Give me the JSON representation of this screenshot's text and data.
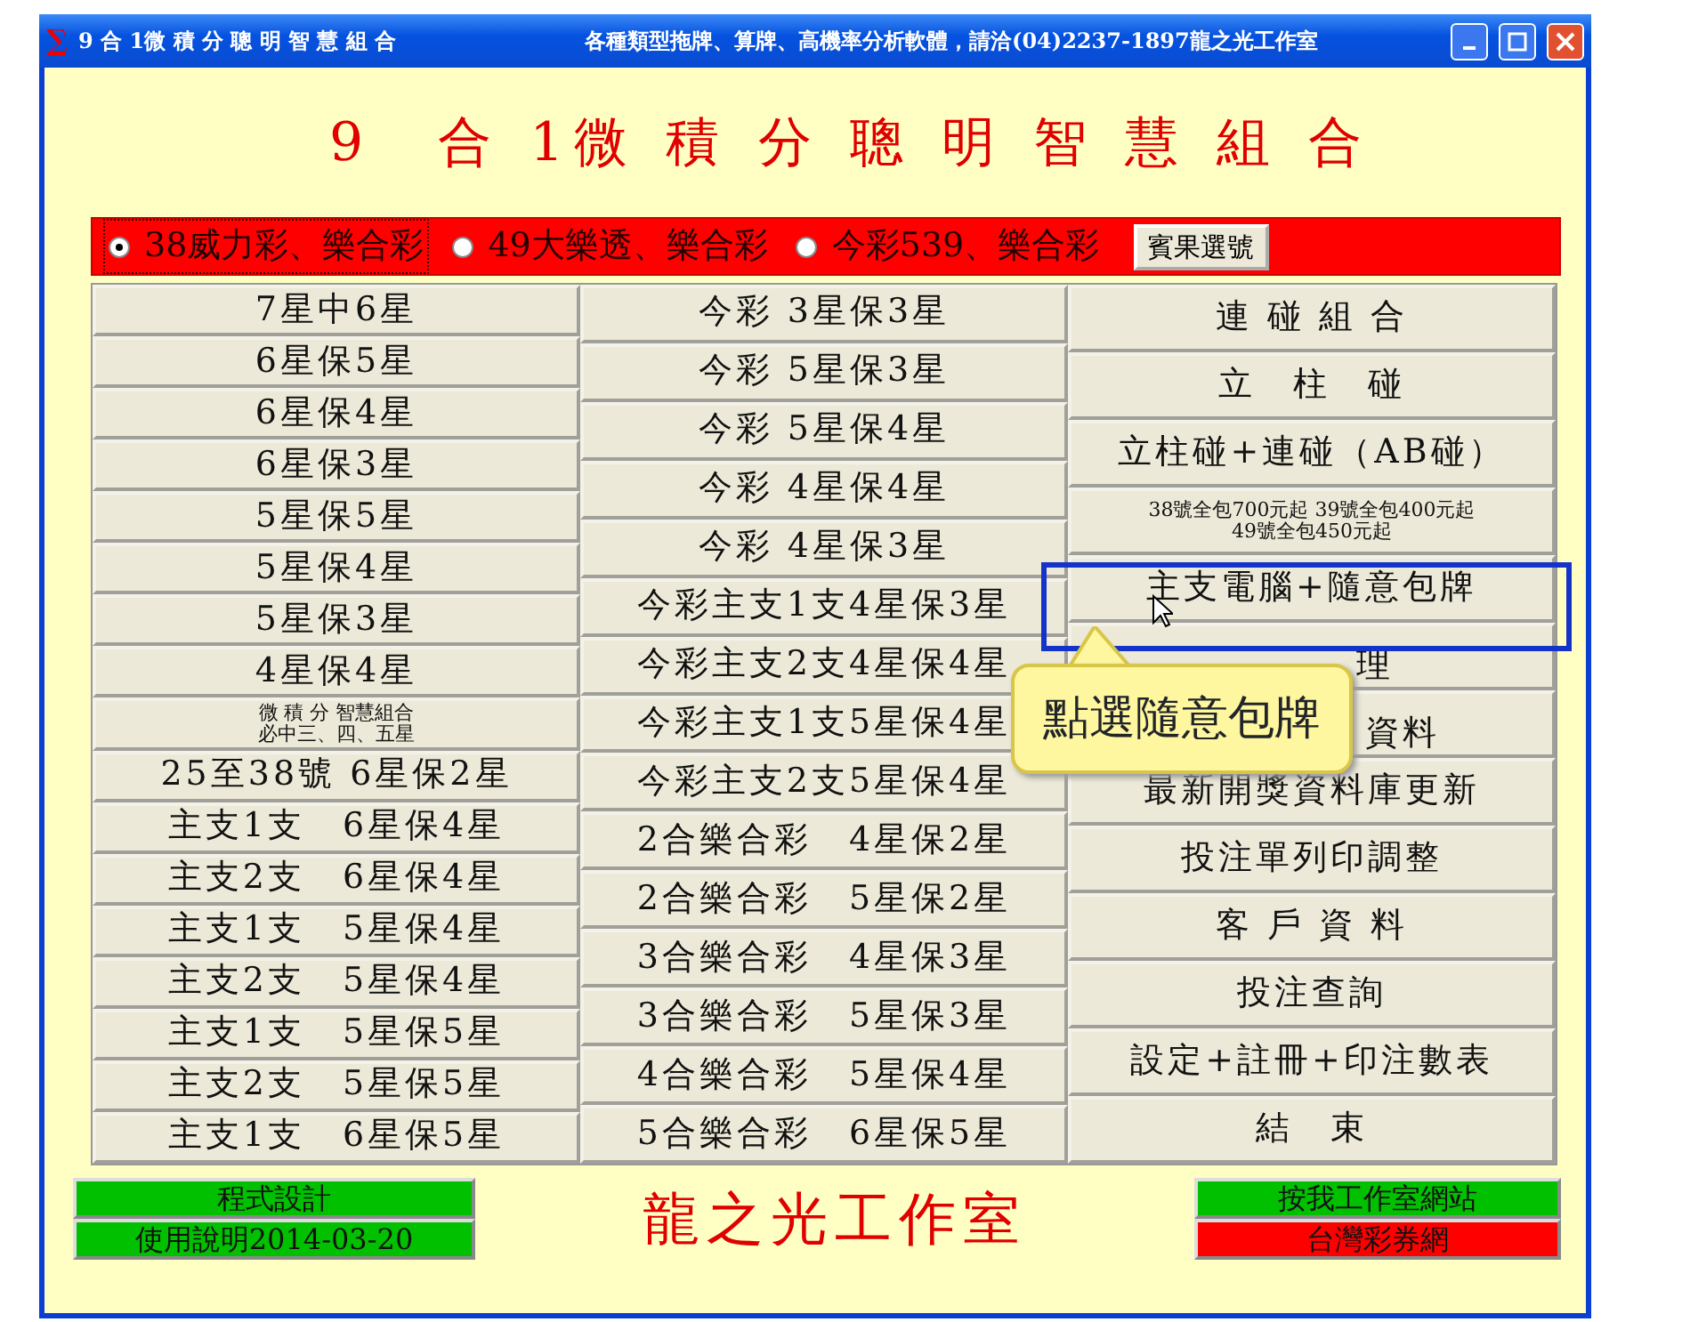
{
  "window": {
    "icon": "∑",
    "title": "9 合 1微 積 分 聰 明 智 慧 組 合",
    "subtitle": "各種類型拖牌、算牌、高機率分析軟體，請洽(04)2237-1897龍之光工作室"
  },
  "heading": "9　合 1微 積 分 聰 明 智 慧 組 合",
  "game_options": [
    {
      "label": "38威力彩、樂合彩",
      "selected": true
    },
    {
      "label": "49大樂透、樂合彩",
      "selected": false
    },
    {
      "label": "今彩539、樂合彩",
      "selected": false
    }
  ],
  "pick_button": "賓果選號",
  "column_1": [
    {
      "label": "7星中6星"
    },
    {
      "label": "6星保5星"
    },
    {
      "label": "6星保4星"
    },
    {
      "label": "6星保3星"
    },
    {
      "label": "5星保5星"
    },
    {
      "label": "5星保4星"
    },
    {
      "label": "5星保3星"
    },
    {
      "label": "4星保4星"
    },
    {
      "lines": [
        "微 積 分 智慧組合",
        "必中三、四、五星"
      ],
      "kind": "small"
    },
    {
      "label": "25至38號 6星保2星"
    },
    {
      "label": "主支1支　6星保4星"
    },
    {
      "label": "主支2支　6星保4星"
    },
    {
      "label": "主支1支　5星保4星"
    },
    {
      "label": "主支2支　5星保4星"
    },
    {
      "label": "主支1支　5星保5星"
    },
    {
      "label": "主支2支　5星保5星"
    },
    {
      "label": "主支1支　6星保5星"
    }
  ],
  "column_2": [
    {
      "label": "今彩 3星保3星"
    },
    {
      "label": "今彩 5星保3星"
    },
    {
      "label": "今彩 5星保4星"
    },
    {
      "label": "今彩 4星保4星"
    },
    {
      "label": "今彩 4星保3星"
    },
    {
      "label": "今彩主支1支4星保3星"
    },
    {
      "label": "今彩主支2支4星保4星"
    },
    {
      "label": "今彩主支1支5星保4星"
    },
    {
      "label": "今彩主支2支5星保4星"
    },
    {
      "label": "2合樂合彩　4星保2星"
    },
    {
      "label": "2合樂合彩　5星保2星"
    },
    {
      "label": "3合樂合彩　4星保3星"
    },
    {
      "label": "3合樂合彩　5星保3星"
    },
    {
      "label": "4合樂合彩　5星保4星"
    },
    {
      "label": "5合樂合彩　6星保5星"
    }
  ],
  "column_3": [
    {
      "label": "連 碰 組 合"
    },
    {
      "label": "立　柱　碰"
    },
    {
      "label": "立柱碰+連碰（AB碰）"
    },
    {
      "lines": [
        "38號全包700元起 39號全包400元起",
        "49號全包450元起"
      ],
      "kind": "small"
    },
    {
      "label": "主支電腦+隨意包牌",
      "highlighted": true
    },
    {
      "label": "理",
      "kind": "covered"
    },
    {
      "label": "資料",
      "kind": "covered"
    },
    {
      "label": "最新開獎資料庫更新"
    },
    {
      "label": "投注單列印調整"
    },
    {
      "label": "客 戶 資 料"
    },
    {
      "label": "投注查詢"
    },
    {
      "label": "設定+註冊+印注數表"
    },
    {
      "label": "結　束"
    }
  ],
  "callout": "點選隨意包牌",
  "footer": {
    "left_buttons": [
      "程式設計",
      "使用說明2014-03-20"
    ],
    "studio": "龍之光工作室",
    "right_buttons": [
      {
        "label": "按我工作室網站",
        "color": "#00c000"
      },
      {
        "label": "台灣彩券網",
        "color": "#ff0000"
      }
    ]
  }
}
